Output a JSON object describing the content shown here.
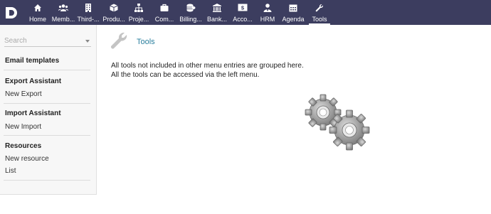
{
  "app": {
    "logo_letter": "D"
  },
  "topnav": {
    "items": [
      {
        "label": "Home",
        "icon": "home-icon"
      },
      {
        "label": "Memb...",
        "icon": "members-icon"
      },
      {
        "label": "Third-...",
        "icon": "building-icon"
      },
      {
        "label": "Produ...",
        "icon": "cube-icon"
      },
      {
        "label": "Proje...",
        "icon": "sitemap-icon"
      },
      {
        "label": "Com...",
        "icon": "briefcase-icon"
      },
      {
        "label": "Billing...",
        "icon": "coins-icon"
      },
      {
        "label": "Bank...",
        "icon": "bank-icon"
      },
      {
        "label": "Acco...",
        "icon": "dollar-icon"
      },
      {
        "label": "HRM",
        "icon": "user-tie-icon"
      },
      {
        "label": "Agenda",
        "icon": "calendar-icon"
      },
      {
        "label": "Tools",
        "icon": "wrench-icon"
      }
    ],
    "active": "Tools"
  },
  "sidebar": {
    "search_placeholder": "Search",
    "sections": [
      {
        "title": "Email templates",
        "links": []
      },
      {
        "title": "Export Assistant",
        "links": [
          "New Export"
        ]
      },
      {
        "title": "Import Assistant",
        "links": [
          "New Import"
        ]
      },
      {
        "title": "Resources",
        "links": [
          "New resource",
          "List"
        ]
      }
    ]
  },
  "main": {
    "title": "Tools",
    "description_line1": "All tools not included in other menu entries are grouped here.",
    "description_line2": "All the tools can be accessed via the left menu.",
    "illustration": "gears-icon"
  },
  "colors": {
    "topbar": "#3c3d5f",
    "title_link": "#2a7f9e",
    "sidebar_bg": "#f7f7f7"
  }
}
